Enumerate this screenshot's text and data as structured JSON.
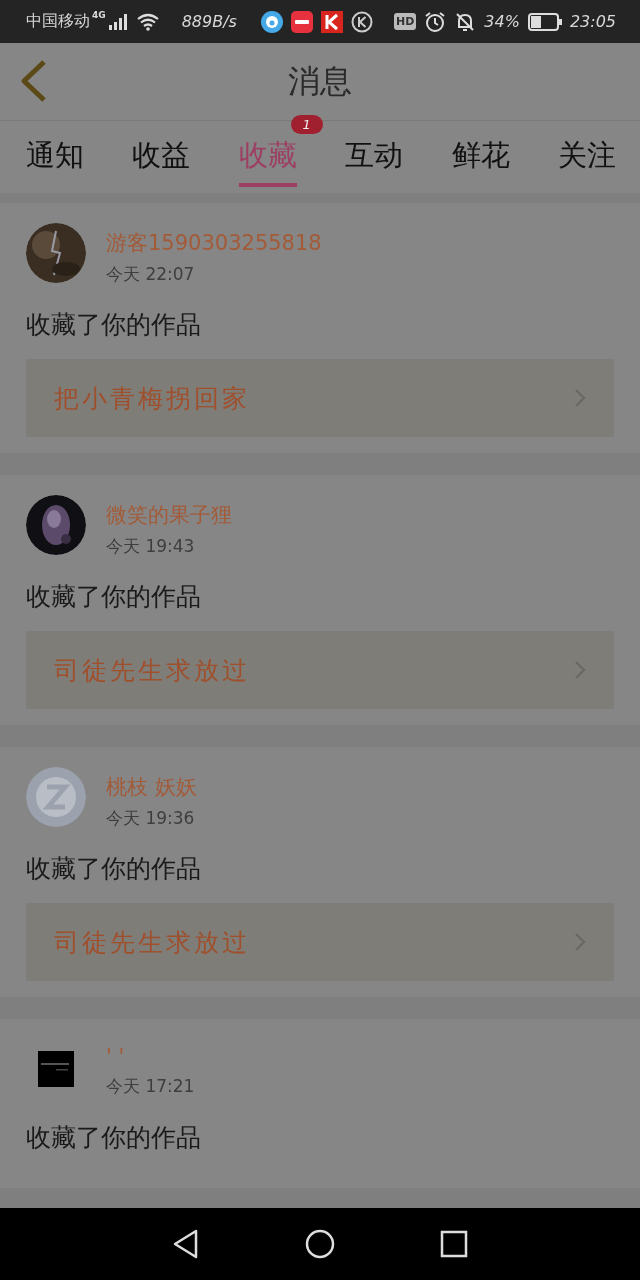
{
  "status_bar": {
    "carrier": "中国移动",
    "network": "4G",
    "speed": "889B/s",
    "hd": "HD",
    "battery": "34%",
    "time": "23:05"
  },
  "header": {
    "title": "消息"
  },
  "tabs": [
    {
      "label": "通知",
      "selected": false
    },
    {
      "label": "收益",
      "selected": false
    },
    {
      "label": "收藏",
      "selected": true,
      "badge": "1"
    },
    {
      "label": "互动",
      "selected": false
    },
    {
      "label": "鲜花",
      "selected": false
    },
    {
      "label": "关注",
      "selected": false
    }
  ],
  "messages": [
    {
      "name": "游客1590303255818",
      "time": "今天  22:07",
      "action": "收藏了你的作品",
      "work": "把小青梅拐回家"
    },
    {
      "name": "微笑的果子狸",
      "time": "今天  19:43",
      "action": "收藏了你的作品",
      "work": "司徒先生求放过"
    },
    {
      "name": "桃枝 妖妖",
      "time": "今天  19:36",
      "action": "收藏了你的作品",
      "work": "司徒先生求放过"
    },
    {
      "name": "' '",
      "time": "今天  17:21",
      "action": "收藏了你的作品"
    }
  ]
}
